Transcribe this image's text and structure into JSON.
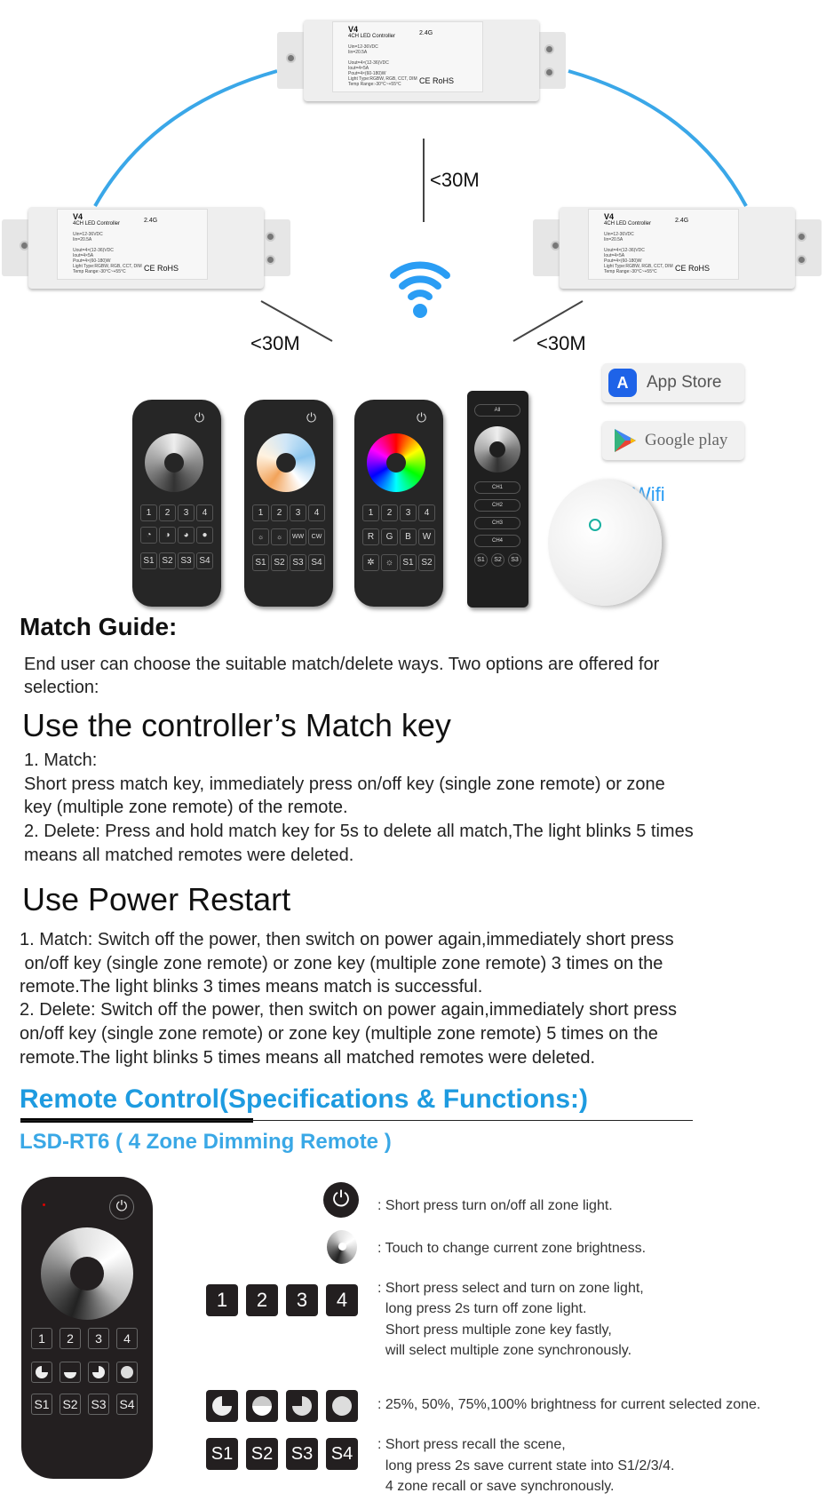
{
  "controller": {
    "model": "V4",
    "name": "4CH LED Controller",
    "band": "2.4G",
    "specs": "Uin=12-36VDC\nIin=20.5A\n\nUout=4×(12-36)VDC\nIout=4×5A\nPout=4×(60-180)W\nLight Type:RGBW, RGB, CCT, DIM\nTemp Range:-30°C~+55°C",
    "cert": "CE RoHS"
  },
  "diagram": {
    "distance_top": "<30M",
    "distance_left": "<30M",
    "distance_right": "<30M",
    "link_color": "#3aa7e8",
    "wifi_color": "#2a9df4"
  },
  "remotes": [
    {
      "zones": [
        "1",
        "2",
        "3",
        "4"
      ],
      "row2": [
        "◔",
        "◑",
        "◕",
        "●"
      ],
      "scenes": [
        "S1",
        "S2",
        "S3",
        "S4"
      ]
    },
    {
      "zones": [
        "1",
        "2",
        "3",
        "4"
      ],
      "row2": [
        "☼",
        "☼",
        "WW",
        "CW"
      ],
      "scenes": [
        "S1",
        "S2",
        "S3",
        "S4"
      ]
    },
    {
      "zones": [
        "1",
        "2",
        "3",
        "4"
      ],
      "row2": [
        "R",
        "G",
        "B",
        "W"
      ],
      "scenes": [
        "✲",
        "☼",
        "S1",
        "S2"
      ]
    },
    {
      "channels": [
        "All",
        "CH1",
        "CH2",
        "CH3",
        "CH4"
      ],
      "scenes": [
        "S1",
        "S2",
        "S3"
      ]
    }
  ],
  "apps": {
    "app_store": "App Store",
    "google_play": "Google play"
  },
  "wifi_label": "Wifi",
  "match_guide": {
    "title": "Match Guide:",
    "intro": [
      "End user can choose the suitable match/delete ways. Two options are offered for",
      "selection:"
    ],
    "option1_title": "Use the controller’s Match key",
    "option1_lines": [
      "1. Match:",
      "Short press match key, immediately press on/off key (single zone remote) or zone",
      "key (multiple zone remote) of the remote.",
      "2. Delete: Press and hold match key for 5s to delete all match,The light blinks 5 times",
      "means all matched remotes were deleted."
    ],
    "option2_title": "Use Power Restart",
    "option2_lines": [
      "1. Match: Switch off the power, then switch on power again,immediately short press",
      " on/off key (single zone remote) or zone key (multiple zone remote) 3 times on the",
      "remote.The light blinks 3 times means match is successful.",
      "2. Delete: Switch off the power, then switch on power again,immediately short press",
      "on/off key (single zone remote) or zone key (multiple zone remote) 5 times on the",
      "remote.The light blinks 5 times means all matched remotes were deleted."
    ]
  },
  "remote_section": {
    "title": "Remote Control(Specifications & Functions:)",
    "subtitle": "LSD-RT6 ( 4 Zone Dimming Remote )",
    "accent": "#1e9be0",
    "zone_keys": [
      "1",
      "2",
      "3",
      "4"
    ],
    "scene_keys": [
      "S1",
      "S2",
      "S3",
      "S4"
    ],
    "brightness_levels": [
      "25%",
      "50%",
      "75%",
      "100%"
    ],
    "functions": [
      {
        "icon": "power-icon",
        "lines": [
          ": Short press turn on/off all zone light."
        ]
      },
      {
        "icon": "touch-wheel-icon",
        "lines": [
          ": Touch to change current zone brightness."
        ]
      },
      {
        "icon": "zone-keys",
        "lines": [
          ": Short press select and turn on zone light,",
          "  long press 2s turn off zone light.",
          "  Short press multiple zone key fastly,",
          "  will select multiple zone synchronously."
        ]
      },
      {
        "icon": "brightness-keys",
        "lines": [
          ": 25%, 50%, 75%,100% brightness for current selected zone."
        ]
      },
      {
        "icon": "scene-keys",
        "lines": [
          ": Short press recall the scene,",
          "  long press 2s save current state into S1/2/3/4.",
          "  4 zone recall or save synchronously."
        ]
      }
    ]
  }
}
